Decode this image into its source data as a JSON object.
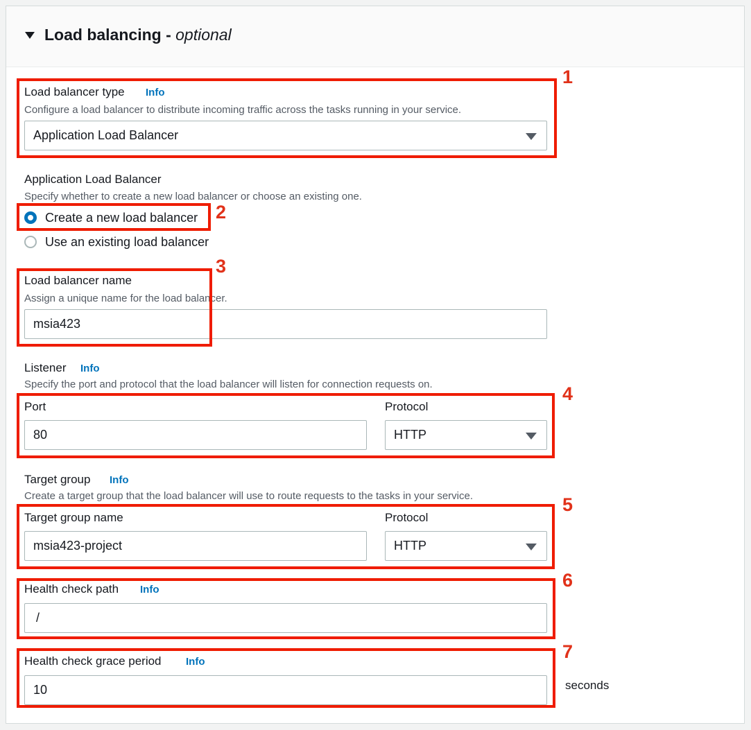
{
  "section": {
    "title": "Load balancing",
    "title_separator": " - ",
    "title_optional": "optional"
  },
  "load_balancer_type": {
    "label": "Load balancer type",
    "info": "Info",
    "description": "Configure a load balancer to distribute incoming traffic across the tasks running in your service.",
    "selected": "Application Load Balancer"
  },
  "alb": {
    "label": "Application Load Balancer",
    "description": "Specify whether to create a new load balancer or choose an existing one.",
    "options": [
      {
        "label": "Create a new load balancer",
        "checked": true
      },
      {
        "label": "Use an existing load balancer",
        "checked": false
      }
    ]
  },
  "lb_name": {
    "label": "Load balancer name",
    "description": "Assign a unique name for the load balancer.",
    "value": "msia423"
  },
  "listener": {
    "label": "Listener",
    "info": "Info",
    "description": "Specify the port and protocol that the load balancer will listen for connection requests on.",
    "port_label": "Port",
    "port_value": "80",
    "protocol_label": "Protocol",
    "protocol_value": "HTTP"
  },
  "target_group": {
    "label": "Target group",
    "info": "Info",
    "description": "Create a target group that the load balancer will use to route requests to the tasks in your service.",
    "name_label": "Target group name",
    "name_value": "msia423-project",
    "protocol_label": "Protocol",
    "protocol_value": "HTTP"
  },
  "health_check_path": {
    "label": "Health check path",
    "info": "Info",
    "value": "/"
  },
  "grace_period": {
    "label": "Health check grace period",
    "info": "Info",
    "value": "10",
    "unit": "seconds"
  },
  "annotations": [
    "1",
    "2",
    "3",
    "4",
    "5",
    "6",
    "7"
  ],
  "colors": {
    "annotation": "#ef1c00",
    "link": "#0073bb",
    "radio_checked": "#0073bb"
  }
}
